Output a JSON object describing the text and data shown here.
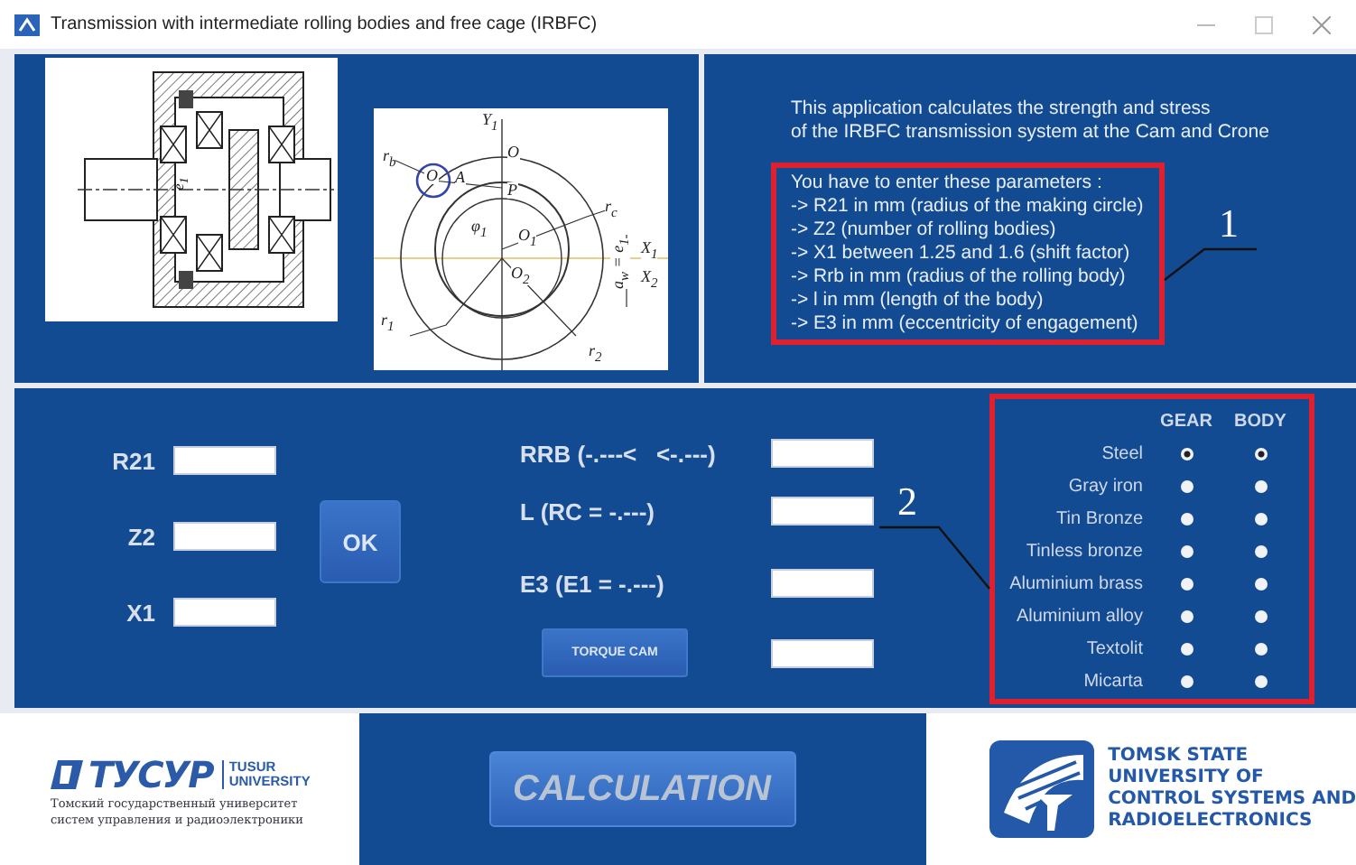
{
  "window": {
    "title": "Transmission with intermediate rolling bodies and free cage (IRBFC)"
  },
  "section_drawing": {
    "label": "e$_{1}$"
  },
  "circle_diagram": {
    "labels": [
      "Y$_{1}$",
      "O",
      "r$_{b}$",
      "O",
      "A",
      "P",
      "r$_{c}$",
      "φ$_{1}$",
      "O$_{1}$",
      "X$_{1}$",
      "O$_{2}$",
      "X$_{2}$",
      "a$_{w}$ = e$_{1}$",
      "r$_{1}$",
      "r$_{2}$"
    ]
  },
  "intro": [
    "This application calculates the strength and stress",
    "of the IRBFC transmission system at the Cam and Crone"
  ],
  "parameters": [
    "You have to enter these parameters :",
    "-> R21 in mm (radius of the making circle)",
    "-> Z2 (number of rolling bodies)",
    "-> X1 between 1.25 and 1.6 (shift factor)",
    "-> Rrb in mm (radius of the rolling body)",
    "-> l in mm (length of the body)",
    "-> E3 in mm (eccentricity of engagement)"
  ],
  "callouts": [
    "1",
    "2"
  ],
  "inputs": [
    {
      "label": "R21"
    },
    {
      "label": "Z2"
    },
    {
      "label": "X1"
    }
  ],
  "ok_button": "OK",
  "results": [
    {
      "kind": "label",
      "label": "RRB (-.---<   <-.---)"
    },
    {
      "kind": "label",
      "label": "L (RC = -.---)"
    },
    {
      "kind": "label",
      "label": "E3 (E1 = -.---)"
    },
    {
      "kind": "button",
      "label": "TORQUE CAM"
    }
  ],
  "materials": {
    "columns": [
      "GEAR",
      "BODY"
    ],
    "rows": [
      {
        "label": "Steel",
        "gear": {
          "selected": true
        },
        "body": {
          "selected": true
        }
      },
      {
        "label": "Gray iron",
        "gear": {
          "selected": false
        },
        "body": {
          "selected": false
        }
      },
      {
        "label": "Tin Bronze",
        "gear": {
          "selected": false
        },
        "body": {
          "selected": false
        }
      },
      {
        "label": "Tinless bronze",
        "gear": {
          "selected": false
        },
        "body": {
          "selected": false
        }
      },
      {
        "label": "Aluminium brass",
        "gear": {
          "selected": false
        },
        "body": {
          "selected": false
        }
      },
      {
        "label": "Aluminium alloy",
        "gear": {
          "selected": false
        },
        "body": {
          "selected": false
        }
      },
      {
        "label": "Textolit",
        "gear": {
          "selected": false
        },
        "body": {
          "selected": false
        }
      },
      {
        "label": "Micarta",
        "gear": {
          "selected": false
        },
        "body": {
          "selected": false
        }
      }
    ]
  },
  "calculation_button": "CALCULATION",
  "left_logo": {
    "wordmark": "ТУСУР",
    "name": [
      "TUSUR",
      "UNIVERSITY"
    ],
    "subtitle": [
      "Томский государственный университет",
      "систем управления и радиоэлектроники"
    ]
  },
  "right_logo": {
    "name": [
      "TOMSK STATE",
      "UNIVERSITY OF",
      "CONTROL SYSTEMS AND",
      "RADIOELECTRONICS"
    ]
  }
}
